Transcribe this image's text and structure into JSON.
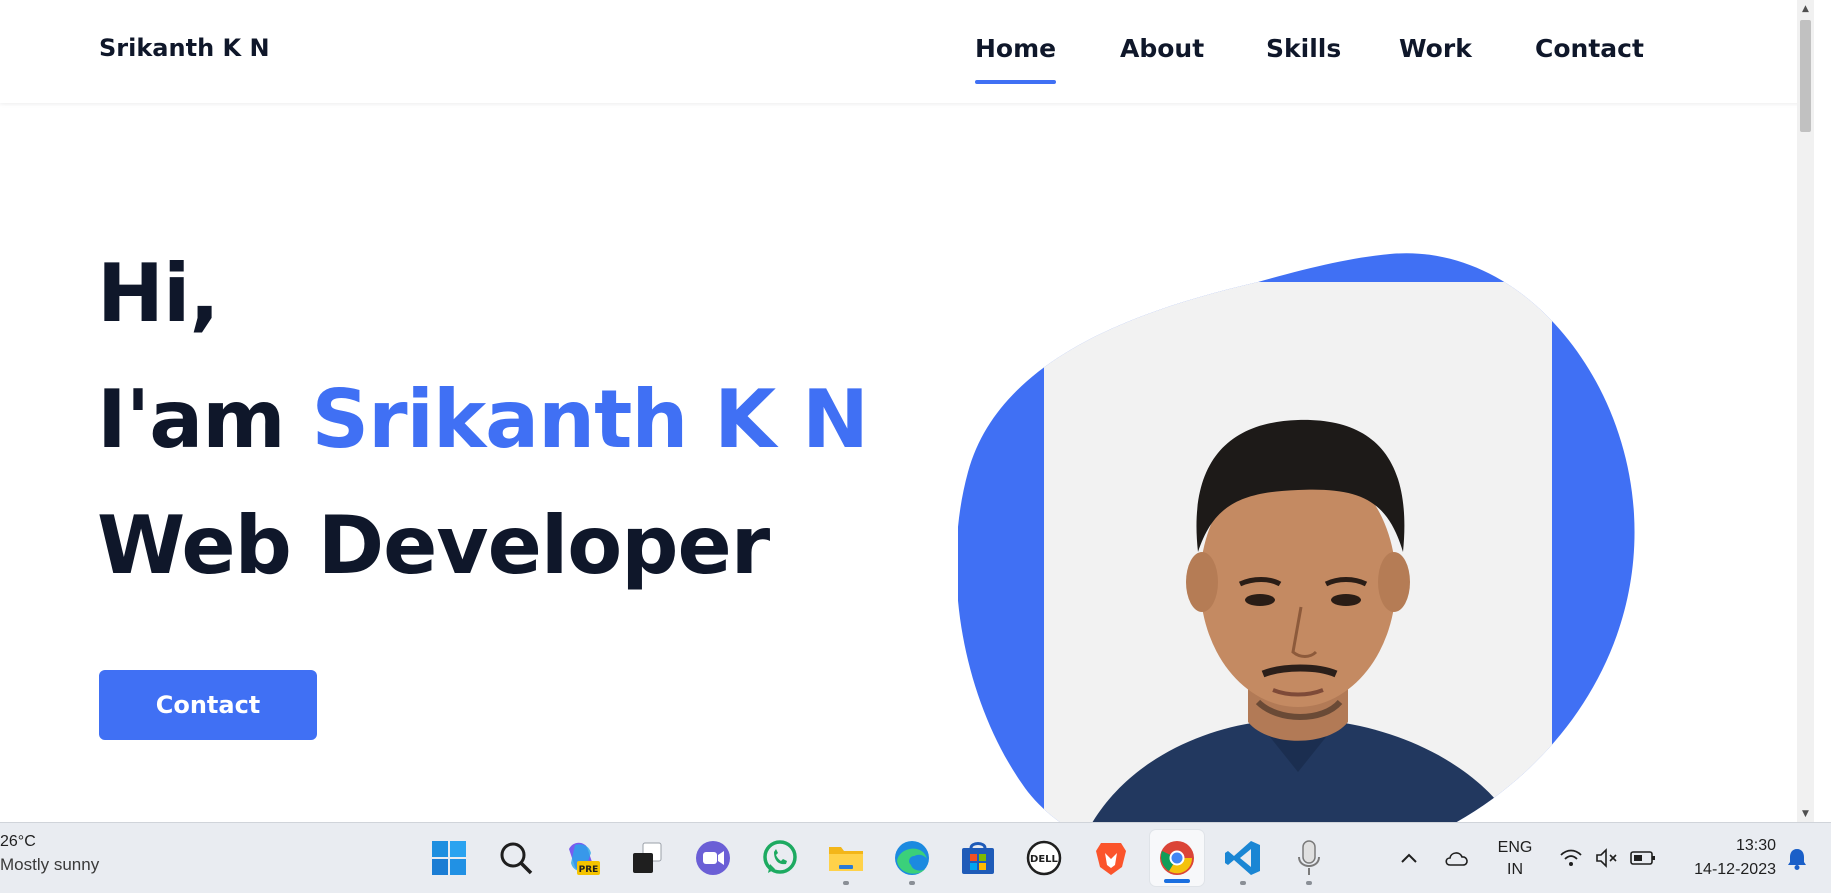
{
  "header": {
    "logo": "Srikanth K N",
    "nav": [
      {
        "label": "Home",
        "active": true
      },
      {
        "label": "About",
        "active": false
      },
      {
        "label": "Skills",
        "active": false
      },
      {
        "label": "Work",
        "active": false
      },
      {
        "label": "Contact",
        "active": false
      }
    ]
  },
  "hero": {
    "greeting": "Hi,",
    "intro": "I'am",
    "name": "Srikanth K N",
    "role": "Web Developer",
    "cta_label": "Contact",
    "photo_icon": "profile-photo",
    "accent_color": "#4070f4"
  },
  "taskbar": {
    "weather": {
      "temp": "26°C",
      "condition": "Mostly sunny"
    },
    "apps": [
      {
        "name": "windows-start-icon"
      },
      {
        "name": "search-icon"
      },
      {
        "name": "copilot-icon"
      },
      {
        "name": "task-view-icon"
      },
      {
        "name": "teams-chat-icon"
      },
      {
        "name": "whatsapp-icon"
      },
      {
        "name": "file-explorer-icon"
      },
      {
        "name": "edge-icon"
      },
      {
        "name": "microsoft-store-icon"
      },
      {
        "name": "dell-icon"
      },
      {
        "name": "brave-icon"
      },
      {
        "name": "chrome-icon"
      },
      {
        "name": "vscode-icon"
      },
      {
        "name": "microphone-icon"
      }
    ],
    "copilot_badge": "PRE",
    "dell_label": "DELL",
    "language": {
      "line1": "ENG",
      "line2": "IN"
    },
    "clock": {
      "time": "13:30",
      "date": "14-12-2023"
    }
  }
}
